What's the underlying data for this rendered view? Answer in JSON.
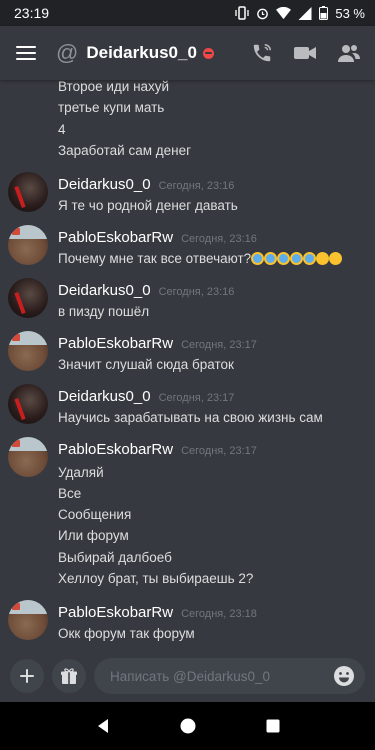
{
  "status_bar": {
    "time": "23:19",
    "battery": "53 %"
  },
  "header": {
    "channel_prefix": "@",
    "title": "Deidarkus0_0"
  },
  "partial_message_lines": [
    "Второе иди нахуй",
    "третье купи мать",
    "4",
    "Заработай сам денег"
  ],
  "messages": [
    {
      "author": "Deidarkus0_0",
      "timestamp": "Сегодня, 23:16",
      "lines": [
        "Я те чо родной денег давать"
      ]
    },
    {
      "author": "PabloEskobarRw",
      "timestamp": "Сегодня, 23:16",
      "lines": [
        "Почему мне так все отвечают?"
      ]
    },
    {
      "author": "Deidarkus0_0",
      "timestamp": "Сегодня, 23:16",
      "lines": [
        "в пизду пошёл"
      ]
    },
    {
      "author": "PabloEskobarRw",
      "timestamp": "Сегодня, 23:17",
      "lines": [
        "Значит слушай сюда браток"
      ]
    },
    {
      "author": "Deidarkus0_0",
      "timestamp": "Сегодня, 23:17",
      "lines": [
        "Научись зарабатывать на свою жизнь сам"
      ]
    },
    {
      "author": "PabloEskobarRw",
      "timestamp": "Сегодня, 23:17",
      "lines": [
        "Удаляй",
        "Все",
        "Сообщения",
        "Или форум",
        "Выбирай далбоеб",
        "Хеллоу брат, ты выбираешь 2?"
      ]
    },
    {
      "author": "PabloEskobarRw",
      "timestamp": "Сегодня, 23:18",
      "lines": [
        "Окк форум так форум"
      ]
    }
  ],
  "composer": {
    "placeholder": "Написать @Deidarkus0_0"
  },
  "icons": {
    "menu": "hamburger-menu-icon",
    "call": "phone-call-icon",
    "video": "video-camera-icon",
    "members": "members-icon",
    "add": "plus-icon",
    "gift": "gift-icon",
    "emoji": "emoji-picker-icon"
  },
  "colors": {
    "background": "#36393f",
    "dnd_status": "#f04747",
    "emoji_yellow": "#f9c22e"
  }
}
